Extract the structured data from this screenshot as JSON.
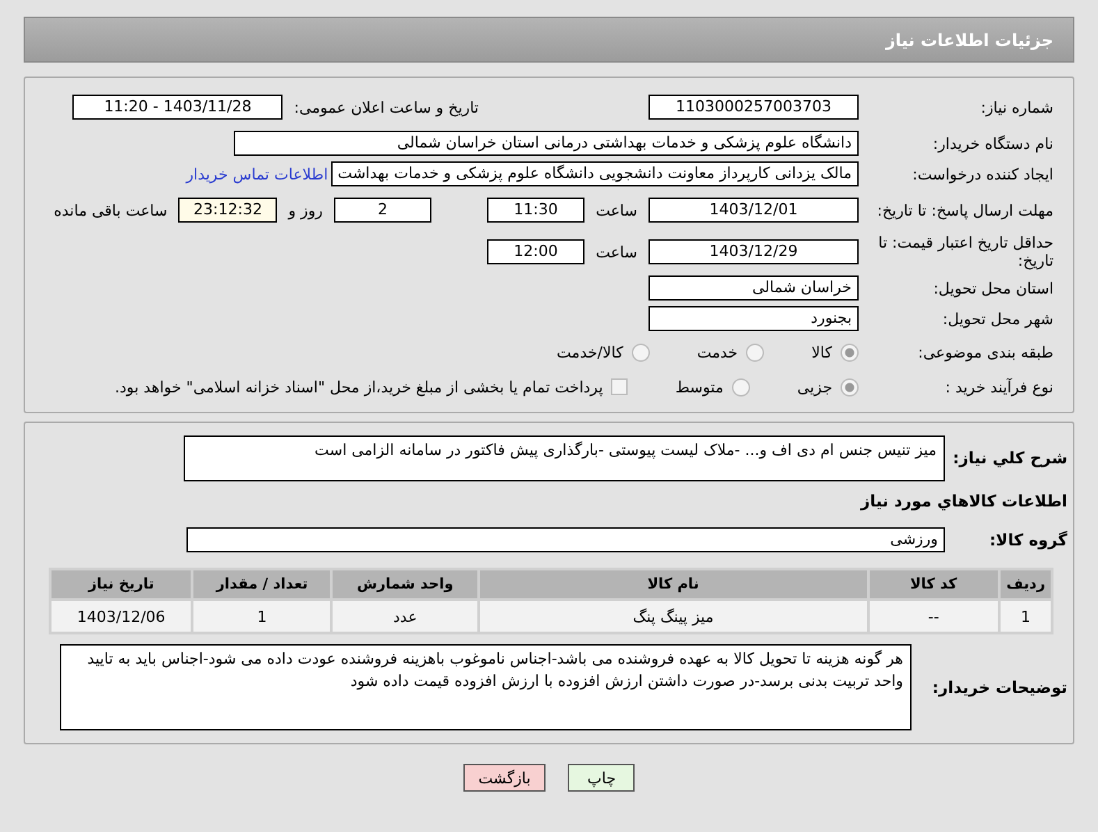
{
  "header": {
    "title": "جزئیات اطلاعات نیاز"
  },
  "need_number": {
    "label": "شماره نیاز:",
    "value": "1103000257003703"
  },
  "announce": {
    "label": "تاریخ و ساعت اعلان عمومی:",
    "value": "1403/11/28 - 11:20"
  },
  "buyer_org": {
    "label": "نام دستگاه خریدار:",
    "value": "دانشگاه علوم پزشکی و خدمات بهداشتی درمانی استان خراسان شمالی"
  },
  "requester": {
    "label": "ایجاد کننده درخواست:",
    "value": "مالک یزدانی کارپرداز معاونت دانشجویی دانشگاه علوم پزشکی و خدمات بهداشت",
    "link": "اطلاعات تماس خریدار"
  },
  "reply_deadline": {
    "label": "مهلت ارسال پاسخ: تا تاریخ:",
    "date": "1403/12/01",
    "time_label": "ساعت",
    "time": "11:30",
    "days": "2",
    "days_label": "روز و",
    "remaining": "23:12:32",
    "remaining_label": "ساعت باقی مانده"
  },
  "price_validity": {
    "label": "حداقل تاریخ اعتبار قیمت: تا تاریخ:",
    "date": "1403/12/29",
    "time_label": "ساعت",
    "time": "12:00"
  },
  "province": {
    "label": "استان محل تحویل:",
    "value": "خراسان شمالی"
  },
  "city": {
    "label": "شهر محل تحویل:",
    "value": "بجنورد"
  },
  "category": {
    "label": "طبقه بندی موضوعی:",
    "options": [
      {
        "label": "کالا",
        "selected": true
      },
      {
        "label": "خدمت",
        "selected": false
      },
      {
        "label": "کالا/خدمت",
        "selected": false
      }
    ]
  },
  "process": {
    "label": "نوع فرآیند خرید :",
    "options": [
      {
        "label": "جزیی",
        "selected": true
      },
      {
        "label": "متوسط",
        "selected": false
      }
    ],
    "payment": {
      "checked": false,
      "text": "پرداخت تمام یا بخشی از مبلغ خرید،از محل \"اسناد خزانه اسلامی\" خواهد بود."
    }
  },
  "description": {
    "label": "شرح کلي نياز:",
    "value": "میز تنیس  جنس ام دی اف و... -ملاک لیست پیوستی -بارگذاری پیش فاکتور در سامانه الزامی است"
  },
  "goods_heading": "اطلاعات کالاهاي مورد نياز",
  "goods_group": {
    "label": "گروه کالا:",
    "value": "ورزشی"
  },
  "table": {
    "columns": [
      "ردیف",
      "کد کالا",
      "نام کالا",
      "واحد شمارش",
      "تعداد / مقدار",
      "تاریخ نیاز"
    ],
    "rows": [
      [
        "1",
        "--",
        "میز پینگ پنگ",
        "عدد",
        "1",
        "1403/12/06"
      ]
    ]
  },
  "buyer_notes": {
    "label": "توضیحات خریدار:",
    "value": "هر گونه هزینه تا تحویل کالا به عهده فروشنده می باشد-اجناس ناموغوب باهزینه فروشنده عودت داده می شود-اجناس باید به تایید واحد تربیت بدنی برسد-در صورت داشتن ارزش افزوده با ارزش افزوده قیمت داده شود"
  },
  "buttons": [
    {
      "label": "چاپ",
      "kind": "print"
    },
    {
      "label": "بازگشت",
      "kind": "back"
    }
  ]
}
